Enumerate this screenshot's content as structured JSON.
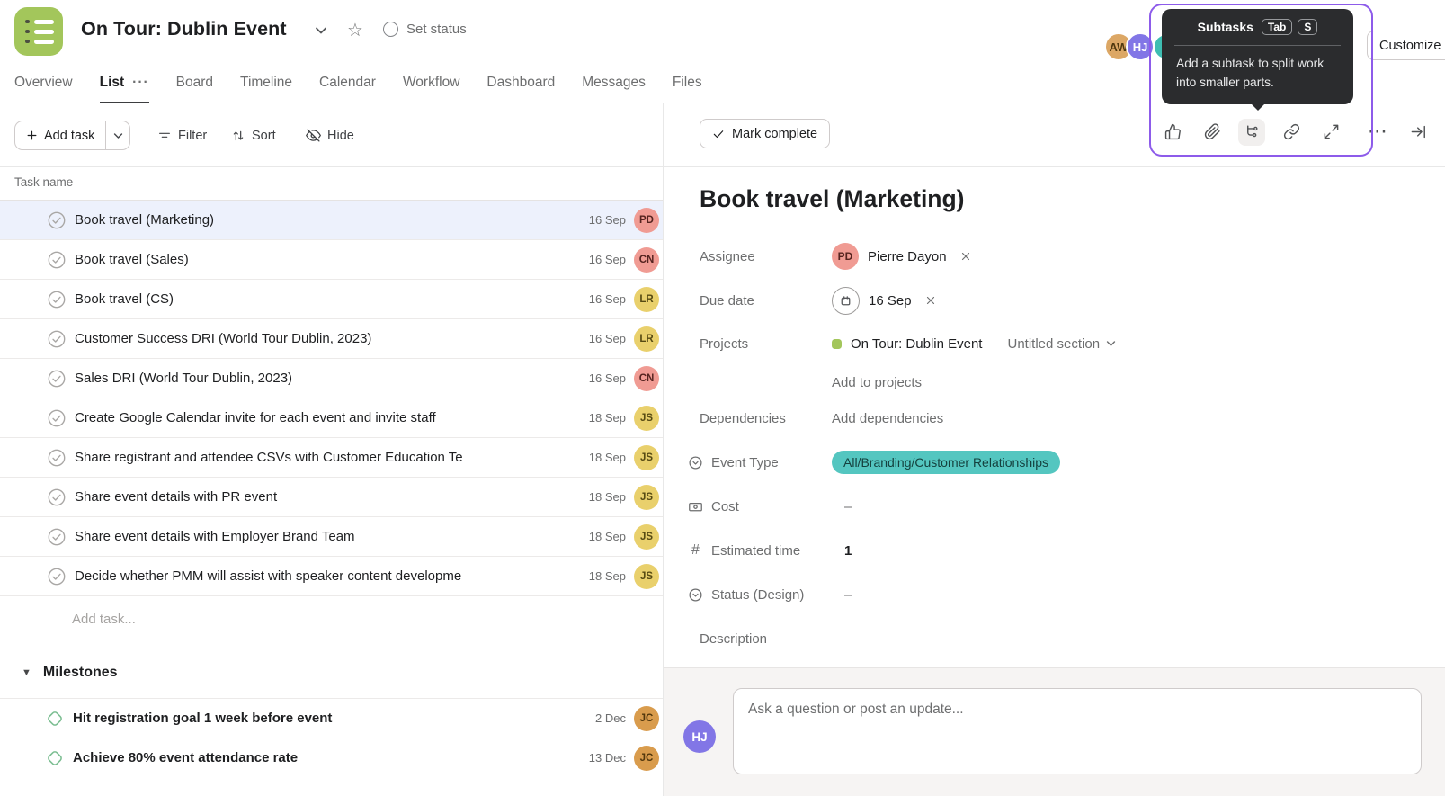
{
  "header": {
    "title": "On Tour: Dublin Event",
    "set_status_label": "Set status",
    "customize_label": "Customize",
    "avatars": [
      {
        "initials": "AW",
        "bg": "#DCA765",
        "fg": "#50380F"
      },
      {
        "initials": "HJ",
        "bg": "#8276E6",
        "fg": "#FFFFFF"
      }
    ]
  },
  "tabs": {
    "items": [
      "Overview",
      "List",
      "Board",
      "Timeline",
      "Calendar",
      "Workflow",
      "Dashboard",
      "Messages",
      "Files"
    ],
    "active": "List",
    "overflow_dots": "···"
  },
  "toolbar": {
    "add_task_label": "Add task",
    "filter_label": "Filter",
    "sort_label": "Sort",
    "hide_label": "Hide"
  },
  "task_list": {
    "column_header": "Task name",
    "tasks": [
      {
        "name": "Book travel (Marketing)",
        "date": "16 Sep",
        "selected": true,
        "avatar": {
          "initials": "PD",
          "bg": "#F09B93",
          "fg": "#55231F"
        }
      },
      {
        "name": "Book travel (Sales)",
        "date": "16 Sep",
        "avatar": {
          "initials": "CN",
          "bg": "#F09B93",
          "fg": "#55231F"
        }
      },
      {
        "name": "Book travel (CS)",
        "date": "16 Sep",
        "avatar": {
          "initials": "LR",
          "bg": "#E9D06C",
          "fg": "#564A13"
        }
      },
      {
        "name": "Customer Success DRI (World Tour Dublin, 2023)",
        "date": "16 Sep",
        "avatar": {
          "initials": "LR",
          "bg": "#E9D06C",
          "fg": "#564A13"
        }
      },
      {
        "name": "Sales DRI (World Tour Dublin, 2023)",
        "date": "16 Sep",
        "avatar": {
          "initials": "CN",
          "bg": "#F09B93",
          "fg": "#55231F"
        }
      },
      {
        "name": "Create Google Calendar invite for each event and invite staff",
        "date": "18 Sep",
        "avatar": {
          "initials": "JS",
          "bg": "#E9D06C",
          "fg": "#564A13"
        }
      },
      {
        "name": "Share registrant and attendee CSVs with Customer Education Te",
        "date": "18 Sep",
        "avatar": {
          "initials": "JS",
          "bg": "#E9D06C",
          "fg": "#564A13"
        }
      },
      {
        "name": "Share event details with PR event",
        "date": "18 Sep",
        "avatar": {
          "initials": "JS",
          "bg": "#E9D06C",
          "fg": "#564A13"
        }
      },
      {
        "name": "Share event details with Employer Brand Team",
        "date": "18 Sep",
        "avatar": {
          "initials": "JS",
          "bg": "#E9D06C",
          "fg": "#564A13"
        }
      },
      {
        "name": "Decide whether PMM will assist with speaker content developme",
        "date": "18 Sep",
        "avatar": {
          "initials": "JS",
          "bg": "#E9D06C",
          "fg": "#564A13"
        }
      }
    ],
    "add_task_placeholder": "Add task...",
    "milestones": {
      "title": "Milestones",
      "items": [
        {
          "name": "Hit registration goal 1 week before event",
          "date": "2 Dec",
          "avatar": {
            "initials": "JC",
            "bg": "#D99C4D",
            "fg": "#53380D"
          }
        },
        {
          "name": "Achieve 80% event attendance rate",
          "date": "13 Dec",
          "avatar": {
            "initials": "JC",
            "bg": "#D99C4D",
            "fg": "#53380D"
          }
        }
      ]
    }
  },
  "detail": {
    "mark_complete_label": "Mark complete",
    "title": "Book travel (Marketing)",
    "assignee": {
      "label": "Assignee",
      "name": "Pierre Dayon",
      "avatar": {
        "initials": "PD",
        "bg": "#F09B93",
        "fg": "#55231F"
      }
    },
    "due_date": {
      "label": "Due date",
      "value": "16 Sep"
    },
    "projects": {
      "label": "Projects",
      "project_name": "On Tour: Dublin Event",
      "section": "Untitled section",
      "add_label": "Add to projects",
      "dot_color": "#A3C65B"
    },
    "dependencies": {
      "label": "Dependencies",
      "add_label": "Add dependencies"
    },
    "event_type": {
      "label": "Event Type",
      "value": "All/Branding/Customer Relationships",
      "pill_bg": "#54C6C0",
      "pill_fg": "#15413E"
    },
    "cost": {
      "label": "Cost",
      "value": "–"
    },
    "estimated_time": {
      "label": "Estimated time",
      "value": "1"
    },
    "status_design": {
      "label": "Status (Design)",
      "value": "–"
    },
    "description_label": "Description"
  },
  "comment": {
    "avatar": {
      "initials": "HJ",
      "bg": "#8276E6",
      "fg": "#FFFFFF"
    },
    "placeholder": "Ask a question or post an update..."
  },
  "tooltip": {
    "title": "Subtasks",
    "keys": [
      "Tab",
      "S"
    ],
    "body": "Add a subtask to split work into smaller parts."
  },
  "colors": {
    "annotation_purple": "#8D5BEA",
    "selected_row": "#EDF1FC",
    "brand_green": "#A3C65B",
    "pill_teal": "#54C6C0",
    "milestone_green": "#7CBE92"
  }
}
